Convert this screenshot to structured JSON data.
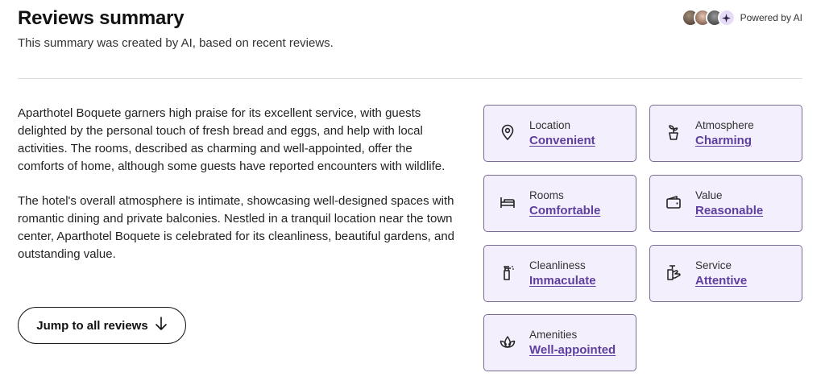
{
  "header": {
    "title": "Reviews summary",
    "subtitle": "This summary was created by AI, based on recent reviews.",
    "powered_by": "Powered by AI"
  },
  "summary": {
    "paragraphs": [
      "Aparthotel Boquete garners high praise for its excellent service, with guests delighted by the personal touch of fresh bread and eggs, and help with local activities. The rooms, described as charming and well-appointed, offer the comforts of home, although some guests have reported encounters with wildlife.",
      "The hotel's overall atmosphere is intimate, showcasing well-designed spaces with romantic dining and private balconies. Nestled in a tranquil location near the town center, Aparthotel Boquete is celebrated for its cleanliness, beautiful gardens, and outstanding value."
    ]
  },
  "jump_button": {
    "label": "Jump to all reviews"
  },
  "categories": [
    {
      "label": "Location",
      "value": "Convenient",
      "icon": "location-pin-icon"
    },
    {
      "label": "Atmosphere",
      "value": "Charming",
      "icon": "plant-pot-icon"
    },
    {
      "label": "Rooms",
      "value": "Comfortable",
      "icon": "bed-icon"
    },
    {
      "label": "Value",
      "value": "Reasonable",
      "icon": "wallet-icon"
    },
    {
      "label": "Cleanliness",
      "value": "Immaculate",
      "icon": "spray-bottle-icon"
    },
    {
      "label": "Service",
      "value": "Attentive",
      "icon": "service-hand-icon"
    },
    {
      "label": "Amenities",
      "value": "Well-appointed",
      "icon": "lotus-icon"
    }
  ],
  "colors": {
    "card_background": "#f3effd",
    "card_border": "#7a6a96",
    "link_accent": "#5e3fa0"
  }
}
